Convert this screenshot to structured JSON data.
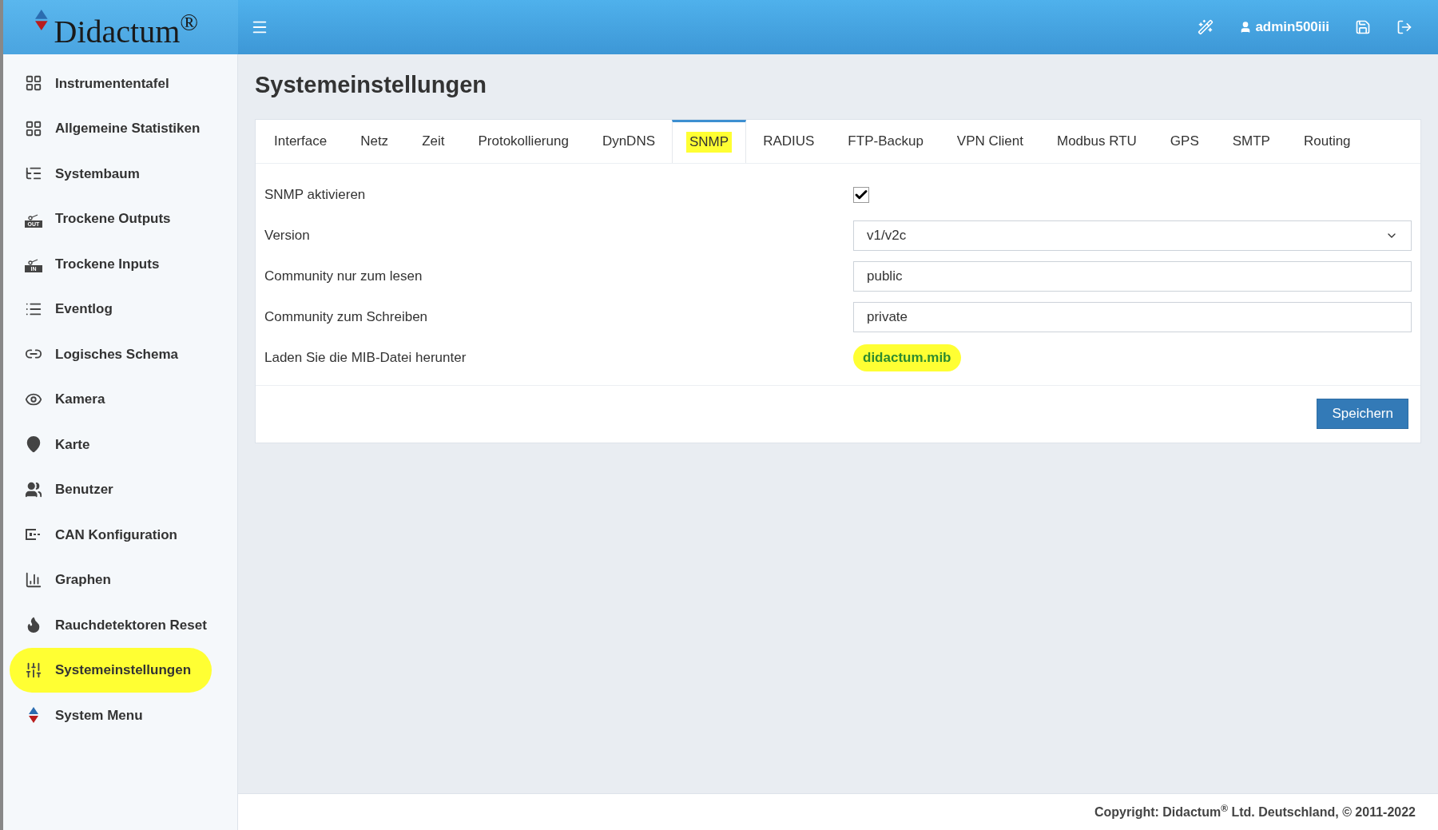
{
  "header": {
    "logo": "Didactum$^{®}$",
    "user": "admin500iii"
  },
  "sidebar": {
    "items": [
      {
        "label": "Instrumententafel",
        "selected": false
      },
      {
        "label": "Allgemeine Statistiken",
        "selected": false
      },
      {
        "label": "Systembaum",
        "selected": false
      },
      {
        "label": "Trockene Outputs",
        "selected": false,
        "badge": "OUT"
      },
      {
        "label": "Trockene Inputs",
        "selected": false,
        "badge": "IN"
      },
      {
        "label": "Eventlog",
        "selected": false
      },
      {
        "label": "Logisches Schema",
        "selected": false
      },
      {
        "label": "Kamera",
        "selected": false
      },
      {
        "label": "Karte",
        "selected": false
      },
      {
        "label": "Benutzer",
        "selected": false
      },
      {
        "label": "CAN Konfiguration",
        "selected": false
      },
      {
        "label": "Graphen",
        "selected": false
      },
      {
        "label": "Rauchdetektoren Reset",
        "selected": false
      },
      {
        "label": "Systemeinstellungen",
        "selected": true
      },
      {
        "label": "System Menu",
        "selected": false
      }
    ]
  },
  "page_title": "Systemeinstellungen",
  "tabs": [
    {
      "label": "Interface",
      "selected": false
    },
    {
      "label": "Netz",
      "selected": false
    },
    {
      "label": "Zeit",
      "selected": false
    },
    {
      "label": "Protokollierung",
      "selected": false
    },
    {
      "label": "DynDNS",
      "selected": false
    },
    {
      "label": "SNMP",
      "selected": true
    },
    {
      "label": "RADIUS",
      "selected": false
    },
    {
      "label": "FTP-Backup",
      "selected": false
    },
    {
      "label": "VPN Client",
      "selected": false
    },
    {
      "label": "Modbus RTU",
      "selected": false
    },
    {
      "label": "GPS",
      "selected": false
    },
    {
      "label": "SMTP",
      "selected": false
    },
    {
      "label": "Routing",
      "selected": false
    }
  ],
  "form": [
    {
      "kind": "checkbox",
      "label": "SNMP aktivieren",
      "checked": true
    },
    {
      "kind": "select",
      "label": "Version",
      "value": "v1/v2c"
    },
    {
      "kind": "text",
      "label": "Community nur zum lesen",
      "value": "public"
    },
    {
      "kind": "text",
      "label": "Community zum Schreiben",
      "value": "private"
    },
    {
      "kind": "link",
      "label": "Laden Sie die MIB-Datei herunter",
      "value": "didactum.mib"
    }
  ],
  "save_button": "Speichern",
  "footer": "Copyright: Didactum$^{®}$ Ltd. Deutschland, © 2011-2022"
}
